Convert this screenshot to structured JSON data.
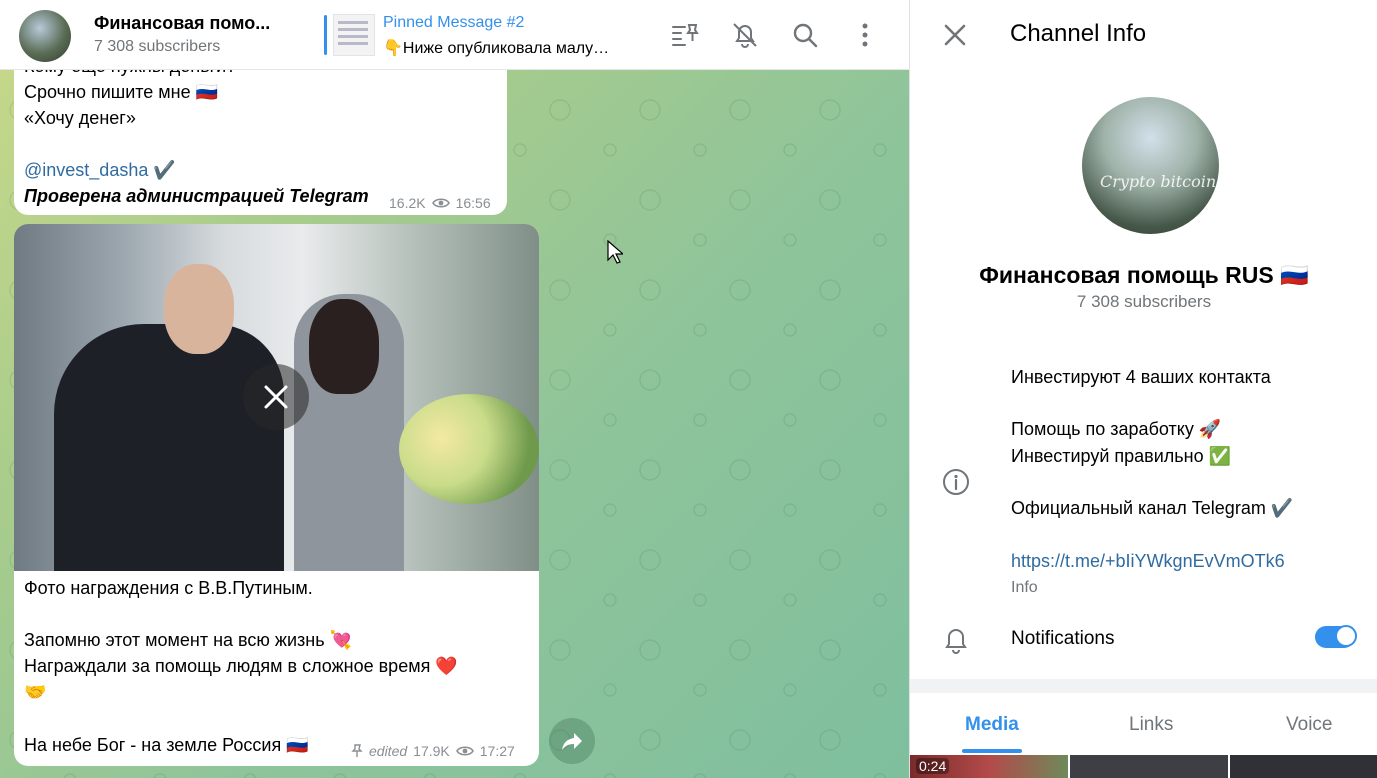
{
  "header": {
    "channel_title": "Финансовая помо...",
    "subscribers": "7 308 subscribers",
    "pinned_title": "Pinned Message #2",
    "pinned_text": "👇Ниже опубликовала малу…",
    "icons": [
      "pinned-list-icon",
      "mute-icon",
      "search-icon",
      "more-icon"
    ]
  },
  "messages": [
    {
      "lines": [
        "Кому еще нужны деньги?",
        "Срочно пишите мне 🇷🇺",
        "«Хочу денег»"
      ],
      "link": "@invest_dasha",
      "link_suffix": "✔️",
      "verified_line": "Проверена администрацией Telegram",
      "views": "16.2K",
      "time": "16:56"
    },
    {
      "caption": [
        "Фото награждения с В.В.Путиным.",
        "Запомню этот момент на всю жизнь 💘",
        "Награждали за помощь людям в сложное время ❤️",
        "🤝",
        "На небе Бог - на земле Россия 🇷🇺"
      ],
      "edited": "edited",
      "views": "17.9K",
      "time": "17:27"
    }
  ],
  "panel": {
    "title": "Channel Info",
    "avatar_text": "Crypto bitcoin",
    "name": "Финансовая помощь RUS 🇷🇺",
    "subscribers": "7 308 subscribers",
    "info_lines": [
      "Инвестируют 4 ваших контакта",
      "Помощь по заработку 🚀",
      "Инвестируй правильно ✅",
      "Официальный канал Telegram ✔️"
    ],
    "link": "https://t.me/+bIiYWkgnEvVmOTk6",
    "info_label": "Info",
    "notifications_label": "Notifications",
    "notifications_on": true,
    "tabs": [
      "Media",
      "Links",
      "Voice"
    ],
    "active_tab": "Media",
    "media_duration": "0:24"
  },
  "colors": {
    "accent": "#3390ec",
    "link": "#2f6ba0"
  }
}
